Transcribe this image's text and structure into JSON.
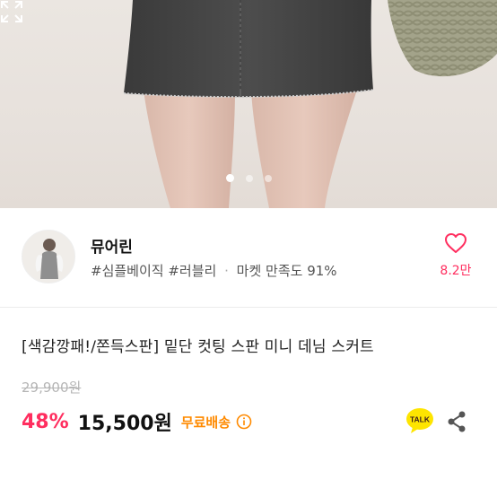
{
  "gallery": {
    "dots": 3,
    "active_index": 0
  },
  "store": {
    "name": "뮤어린",
    "tags": "#심플베이직 #러블리",
    "separator": "·",
    "satisfaction": "마켓 만족도 91%",
    "like_count": "8.2만"
  },
  "product": {
    "title": "[색감깡패!/쫀득스판] 밑단 컷팅 스판 미니 데님 스커트",
    "original_price": "29,900원",
    "discount": "48%",
    "price": "15,500원",
    "shipping": "무료배송"
  },
  "icons": {
    "talk_label": "TALK"
  },
  "colors": {
    "accent_pink": "#ff2e5f",
    "shipping_orange": "#ff8a00",
    "talk_yellow": "#fee500"
  }
}
